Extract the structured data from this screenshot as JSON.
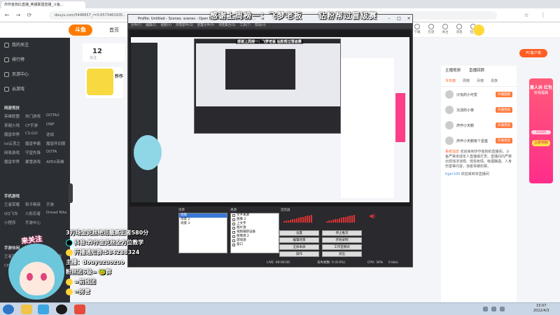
{
  "browser": {
    "tab_title": "炸炸金狗比直播_英雄联盟直播_斗鱼...",
    "url": "douyu.com/5448657_r=0.6573461935..."
  },
  "douyu": {
    "logo": "斗鱼",
    "home_link": "首页",
    "top_icons": [
      "下载",
      "历史",
      "关注",
      "消息",
      "任务"
    ],
    "pc_button": "PC客户端",
    "follow_count": "12",
    "follow_label": "关注",
    "room_title_short": "炸作",
    "sidebar_main": [
      "我的关注",
      "排行榜",
      "页游中心",
      "云游戏"
    ],
    "sidebar_sections": [
      {
        "title": "网游竞技",
        "items": [
          "英雄联盟",
          "热门游戏",
          "DOTA2",
          "穿越火线",
          "CF手游",
          "DNF",
          "魔兽世界",
          "CS:GO",
          "逆战",
          "lol云顶之",
          "魔兽争霸",
          "魔兽怀旧服",
          "网易游戏",
          "守望先锋",
          "DOTA",
          "魔兽世界",
          "暴雪游戏",
          "APEX英雄"
        ]
      },
      {
        "title": "手机游戏",
        "items": [
          "王者荣耀",
          "和平精英",
          "手游",
          "QQ飞车",
          "火影忍者",
          "Dread Nite",
          "小程序",
          "手游中心"
        ]
      },
      {
        "title": "手游休闲",
        "items": [
          "王者荣耀",
          "LOL手游",
          "主机游戏",
          "CF手游"
        ]
      }
    ],
    "right_panel": {
      "header_tabs": [
        "主播视频",
        "直播回顾"
      ],
      "rank_tabs": [
        "今日榜",
        "周榜",
        "月榜",
        "贵族"
      ],
      "rank_rows": [
        {
          "name": "沙瓦的小可爱",
          "btn": "开播提醒"
        },
        {
          "name": "沉浸的小夜",
          "btn": "开通贵族"
        },
        {
          "name": "炸作小天鹅",
          "btn": "开通贵族"
        },
        {
          "name": "炸作小天鹅有个星座",
          "btn": "开通贵族"
        }
      ],
      "chat": [
        {
          "name": "系统消息",
          "text": "欢迎来到炸作金狗的直播间，斗鱼严禁未成年人直播或打赏。直播间内严禁出现违法违规、低俗色情、吸烟酗酒、人身伤害等内容，违者将被封禁。"
        },
        {
          "name": "tiger100",
          "text": "欢迎来到本直播间"
        }
      ]
    },
    "ad": {
      "title": "惠人共 红包",
      "sub": "抢福福袋",
      "progress": "0/1500",
      "button": "立即领取"
    }
  },
  "obs": {
    "title": "Profile: Untitled - Scenes: scenes - Open Broadcaster Software 26...",
    "menu": [
      "文件(F)",
      "编辑(E)",
      "视图(V)",
      "停靠部件(D)",
      "配置文件(P)",
      "场景集合(S)",
      "工具(T)",
      "帮助(H)"
    ],
    "preview_banner": "感谢上周榜一：飞梦老板    钻粉帮过晋级赛",
    "scenes_header": "场景",
    "scenes": [
      "场景",
      "场景 2",
      "场景 3"
    ],
    "sources_header": "来源",
    "sources": [
      "文字来源",
      "图像 2",
      "上文字",
      "图片源",
      "视频捕获设备",
      "图像源 2",
      "游戏源",
      "窗口"
    ],
    "mixer_header": "混音器",
    "controls": [
      [
        "设置",
        "停止推流"
      ],
      [
        "编辑场景",
        "开始录制"
      ],
      [
        "全屏本屏",
        "工作室模式"
      ],
      [
        "操作",
        "退出"
      ]
    ],
    "status": {
      "dropped": "丢失帧数: 0 (0.0%)",
      "live": "LIVE: 00:00:00",
      "rec": "REC: 00:00:00",
      "cpu": "CPU: 30%",
      "fps": "30.00 fps",
      "kbps": "0 kb/s"
    }
  },
  "overlay": {
    "title_left": "感谢上周榜一：飞梦老板",
    "title_right": "钻粉帮过晋级赛",
    "speech": "来关注",
    "lines": [
      {
        "icon": "",
        "text": "3万场金克丝绝活最高王者580分"
      },
      {
        "icon": "tiktok",
        "text": "抖音:炸作金克丝全方位教学"
      },
      {
        "icon": "",
        "text": "开播通知群:584288324"
      },
      {
        "icon": "",
        "text": "主播：douyuzuozuo"
      },
      {
        "icon": "",
        "text": "粉丝团6级= 🐸群"
      },
      {
        "icon": "",
        "text": "=前线团"
      },
      {
        "icon": "",
        "text": "=房管"
      }
    ]
  },
  "taskbar": {
    "time": "15:07",
    "date": "2022/4/3"
  },
  "colors": {
    "douyu_orange": "#ff7b00",
    "douyu_accent": "#ff5d23",
    "sidebar_bg": "#2b2e33",
    "obs_bg": "#2a2a2e",
    "ad_pink": "#ff2d8a"
  }
}
